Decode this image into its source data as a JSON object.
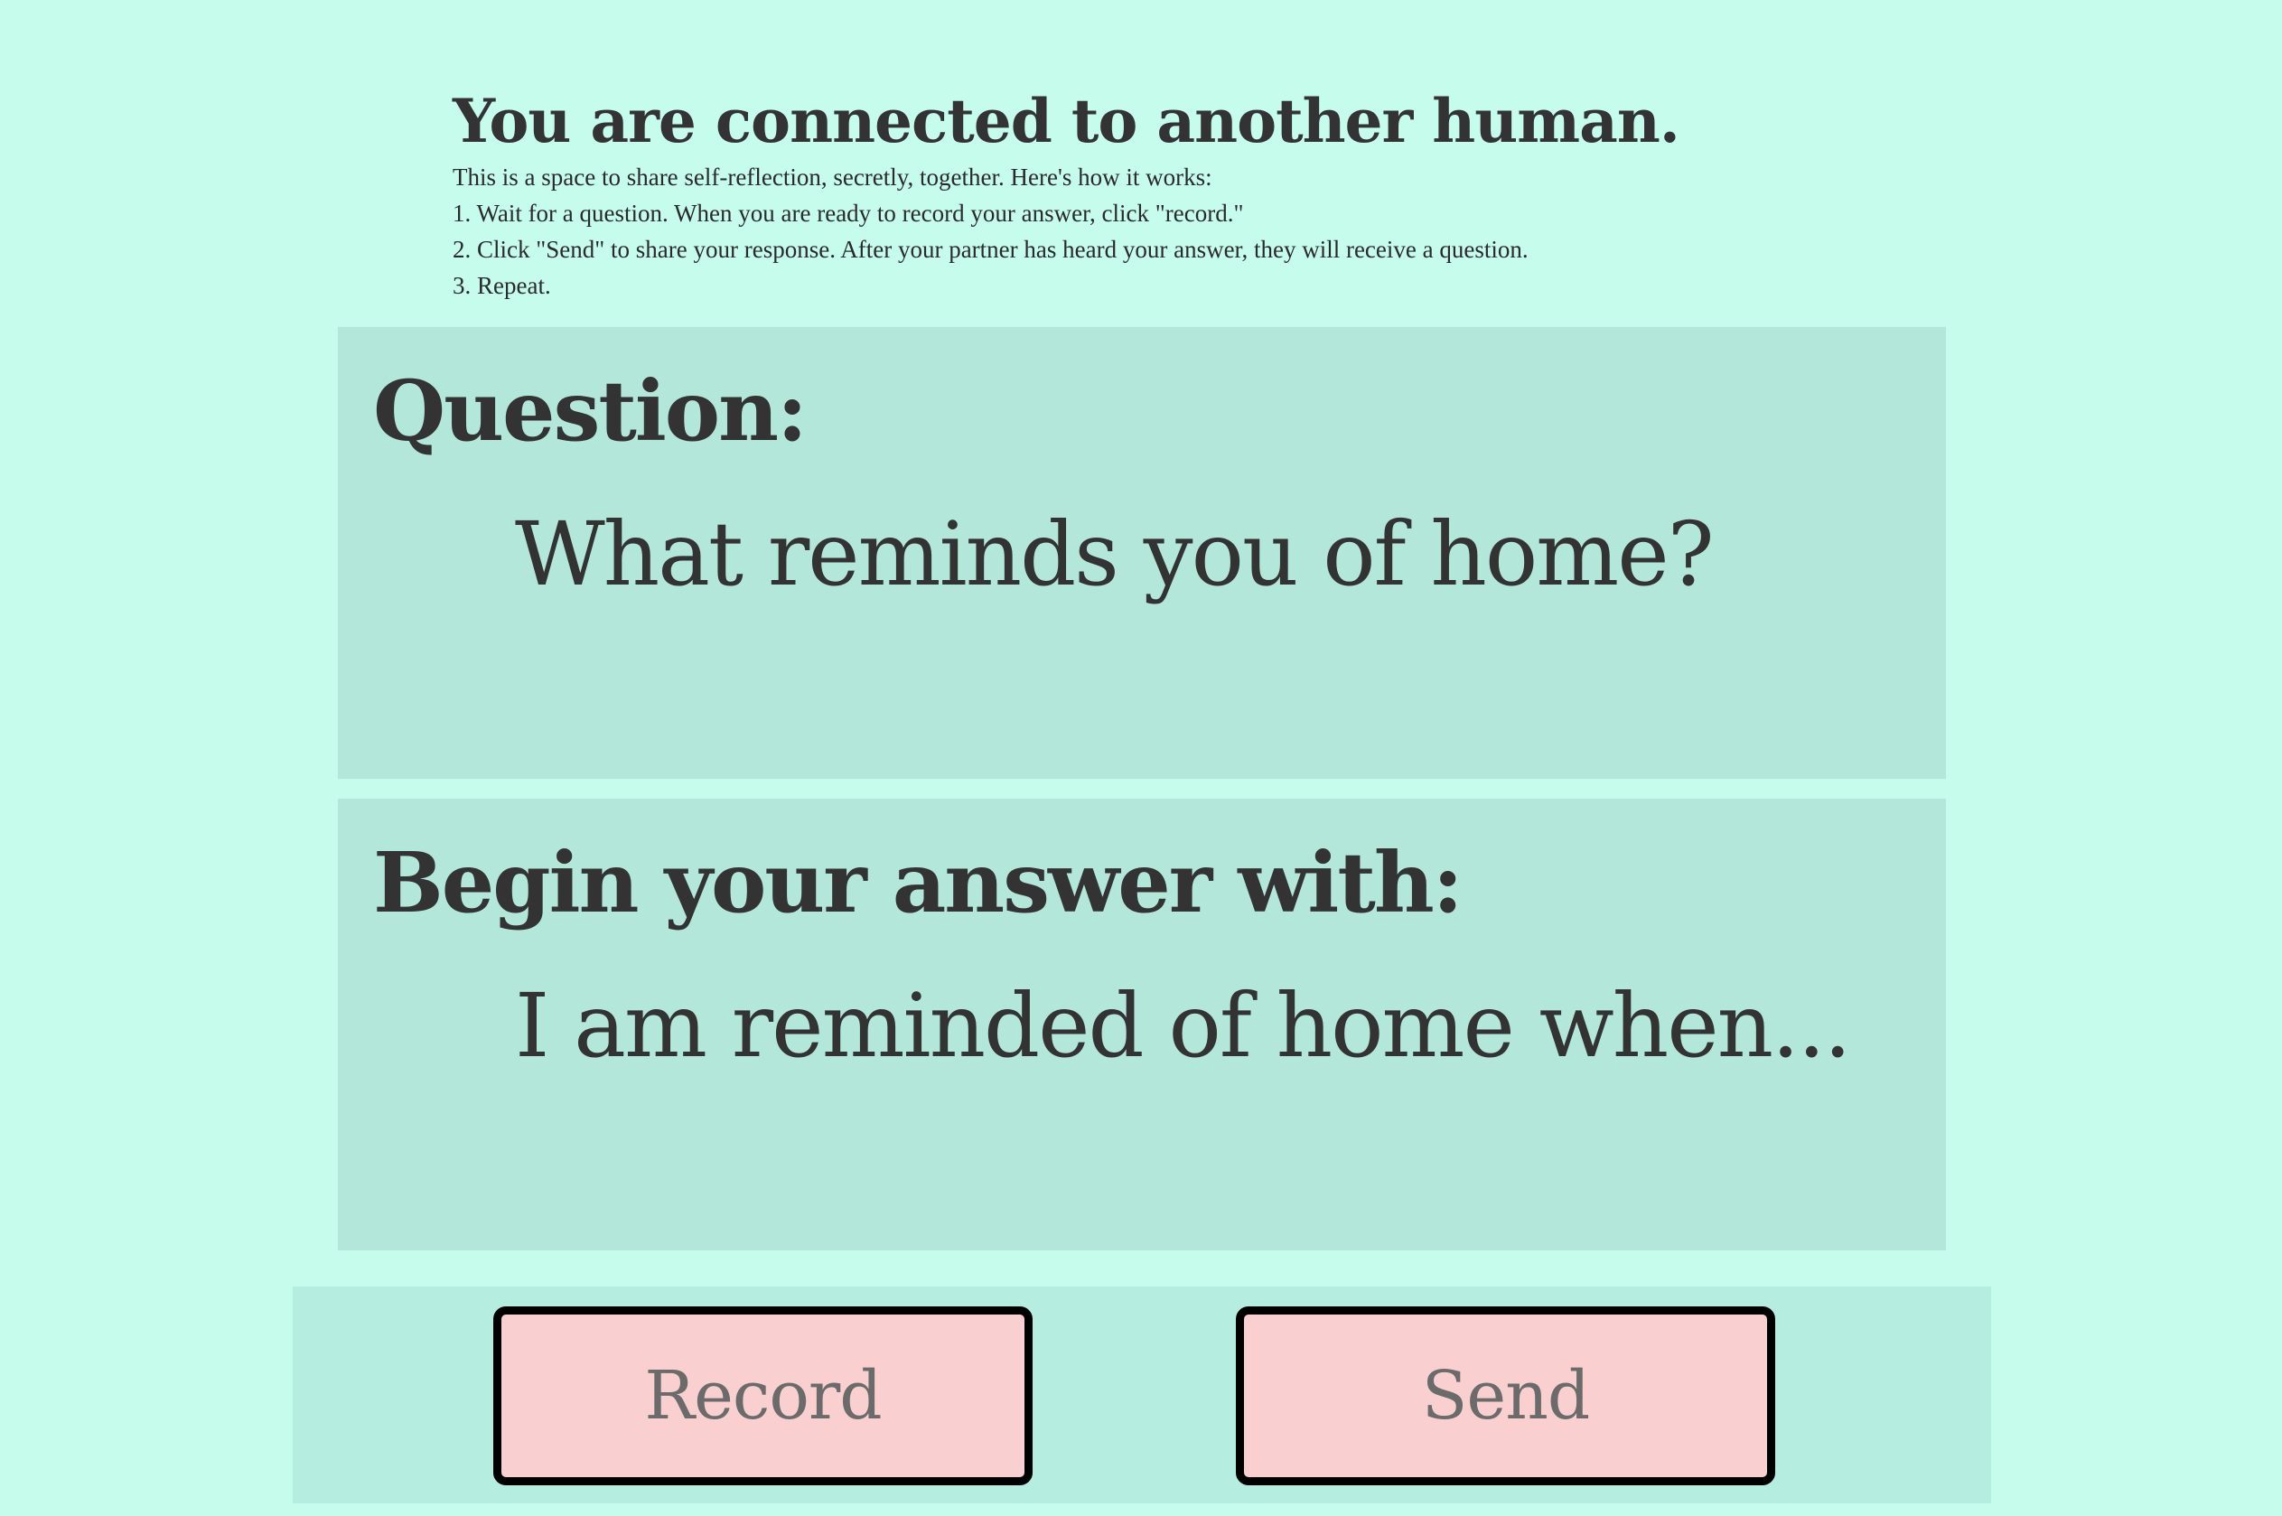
{
  "header": {
    "title": "You are connected to another human.",
    "intro": "This is a space to share self-reflection, secretly, together. Here's how it works:",
    "steps": [
      "1. Wait for a question. When you are ready to record your answer, click \"record.\"",
      "2. Click \"Send\" to share your response. After your partner has heard your answer, they will receive a question.",
      "3. Repeat."
    ]
  },
  "question_panel": {
    "label": "Question:",
    "text": "What reminds you of home?"
  },
  "answer_panel": {
    "label": "Begin your answer with:",
    "text": "I am reminded of home when..."
  },
  "buttons": {
    "record_label": "Record",
    "send_label": "Send"
  },
  "colors": {
    "page_background": "#c6fcec",
    "panel_background": "#b3e7da",
    "button_bar_background": "#b5ede0",
    "button_fill": "#facfcf",
    "button_border": "#000000",
    "text": "#333333"
  }
}
